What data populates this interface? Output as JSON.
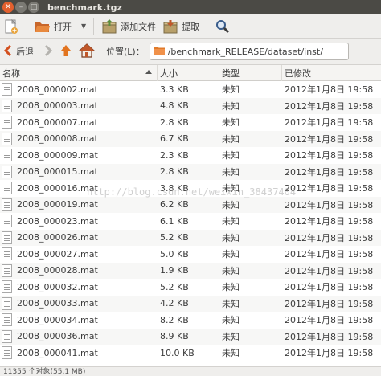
{
  "window": {
    "title": "benchmark.tgz"
  },
  "toolbar": {
    "open_label": "打开",
    "add_files_label": "添加文件",
    "extract_label": "提取"
  },
  "location": {
    "back_label": "后退",
    "location_label": "位置(L)：",
    "path": "/benchmark_RELEASE/dataset/inst/"
  },
  "columns": {
    "name": "名称",
    "size": "大小",
    "type": "类型",
    "modified": "已修改"
  },
  "files": [
    {
      "name": "2008_000002.mat",
      "size": "3.3 KB",
      "type": "未知",
      "modified": "2012年1月8日 19:58"
    },
    {
      "name": "2008_000003.mat",
      "size": "4.8 KB",
      "type": "未知",
      "modified": "2012年1月8日 19:58"
    },
    {
      "name": "2008_000007.mat",
      "size": "2.8 KB",
      "type": "未知",
      "modified": "2012年1月8日 19:58"
    },
    {
      "name": "2008_000008.mat",
      "size": "6.7 KB",
      "type": "未知",
      "modified": "2012年1月8日 19:58"
    },
    {
      "name": "2008_000009.mat",
      "size": "2.3 KB",
      "type": "未知",
      "modified": "2012年1月8日 19:58"
    },
    {
      "name": "2008_000015.mat",
      "size": "2.8 KB",
      "type": "未知",
      "modified": "2012年1月8日 19:58"
    },
    {
      "name": "2008_000016.mat",
      "size": "3.8 KB",
      "type": "未知",
      "modified": "2012年1月8日 19:58"
    },
    {
      "name": "2008_000019.mat",
      "size": "6.2 KB",
      "type": "未知",
      "modified": "2012年1月8日 19:58"
    },
    {
      "name": "2008_000023.mat",
      "size": "6.1 KB",
      "type": "未知",
      "modified": "2012年1月8日 19:58"
    },
    {
      "name": "2008_000026.mat",
      "size": "5.2 KB",
      "type": "未知",
      "modified": "2012年1月8日 19:58"
    },
    {
      "name": "2008_000027.mat",
      "size": "5.0 KB",
      "type": "未知",
      "modified": "2012年1月8日 19:58"
    },
    {
      "name": "2008_000028.mat",
      "size": "1.9 KB",
      "type": "未知",
      "modified": "2012年1月8日 19:58"
    },
    {
      "name": "2008_000032.mat",
      "size": "5.2 KB",
      "type": "未知",
      "modified": "2012年1月8日 19:58"
    },
    {
      "name": "2008_000033.mat",
      "size": "4.2 KB",
      "type": "未知",
      "modified": "2012年1月8日 19:58"
    },
    {
      "name": "2008_000034.mat",
      "size": "8.2 KB",
      "type": "未知",
      "modified": "2012年1月8日 19:58"
    },
    {
      "name": "2008_000036.mat",
      "size": "8.9 KB",
      "type": "未知",
      "modified": "2012年1月8日 19:58"
    },
    {
      "name": "2008_000041.mat",
      "size": "10.0 KB",
      "type": "未知",
      "modified": "2012年1月8日 19:58"
    }
  ],
  "watermark": "http://blog.csdn.net/weixin_38437404",
  "status": {
    "text": "11355 个对象(55.1 MB)"
  },
  "colors": {
    "titlebar": "#4b4a45",
    "close_button": "#e3602e",
    "folder_orange": "#e07a2a"
  }
}
